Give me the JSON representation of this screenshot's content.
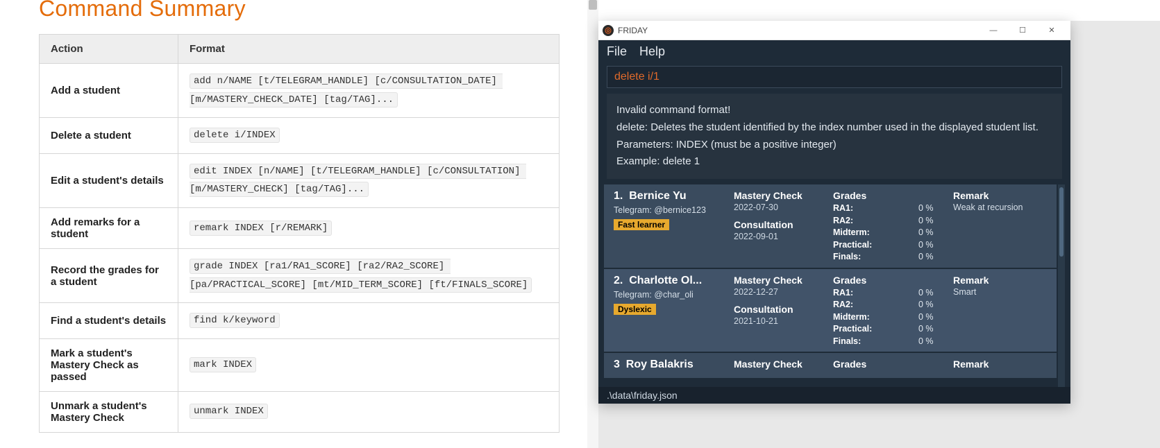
{
  "doc": {
    "heading": "Command Summary",
    "columns": [
      "Action",
      "Format"
    ],
    "rows": [
      {
        "action": "Add a student",
        "format": "add n/NAME [t/TELEGRAM_HANDLE] [c/CONSULTATION_DATE] [m/MASTERY_CHECK_DATE] [tag/TAG]..."
      },
      {
        "action": "Delete a student",
        "format": "delete i/INDEX"
      },
      {
        "action": "Edit a student's details",
        "format": "edit INDEX [n/NAME] [t/TELEGRAM_HANDLE] [c/CONSULTATION] [m/MASTERY_CHECK] [tag/TAG]..."
      },
      {
        "action": "Add remarks for a student",
        "format": "remark INDEX [r/REMARK]"
      },
      {
        "action": "Record the grades for a student",
        "format": "grade INDEX [ra1/RA1_SCORE] [ra2/RA2_SCORE] [pa/PRACTICAL_SCORE] [mt/MID_TERM_SCORE] [ft/FINALS_SCORE]"
      },
      {
        "action": "Find a student's details",
        "format": "find k/keyword"
      },
      {
        "action": "Mark a student's Mastery Check as passed",
        "format": "mark INDEX"
      },
      {
        "action": "Unmark a student's Mastery Check",
        "format": "unmark INDEX"
      }
    ]
  },
  "app": {
    "title": "FRIDAY",
    "menu": {
      "file": "File",
      "help": "Help"
    },
    "command_text": "delete i/1",
    "result_lines": [
      "Invalid command format!",
      "delete: Deletes the student identified by the index number used in the displayed student list.",
      "Parameters: INDEX (must be a positive integer)",
      "Example: delete 1"
    ],
    "labels": {
      "mastery": "Mastery Check",
      "consult": "Consultation",
      "grades": "Grades",
      "remark": "Remark",
      "ra1": "RA1:",
      "ra2": "RA2:",
      "midterm": "Midterm:",
      "practical": "Practical:",
      "finals": "Finals:"
    },
    "students": [
      {
        "idx": "1.",
        "name": "Bernice Yu",
        "telegram": "Telegram: @bernice123",
        "tag": "Fast learner",
        "mastery": "2022-07-30",
        "consult": "2022-09-01",
        "grades": {
          "ra1": "0 %",
          "ra2": "0 %",
          "midterm": "0 %",
          "practical": "0 %",
          "finals": "0 %"
        },
        "remark": "Weak at recursion"
      },
      {
        "idx": "2.",
        "name": "Charlotte Ol...",
        "telegram": "Telegram: @char_oli",
        "tag": "Dyslexic",
        "mastery": "2022-12-27",
        "consult": "2021-10-21",
        "grades": {
          "ra1": "0 %",
          "ra2": "0 %",
          "midterm": "0 %",
          "practical": "0 %",
          "finals": "0 %"
        },
        "remark": "Smart"
      },
      {
        "idx": "3",
        "name": "Roy Balakris",
        "mastery_hdr_only": true
      }
    ],
    "statusbar": ".\\data\\friday.json"
  }
}
